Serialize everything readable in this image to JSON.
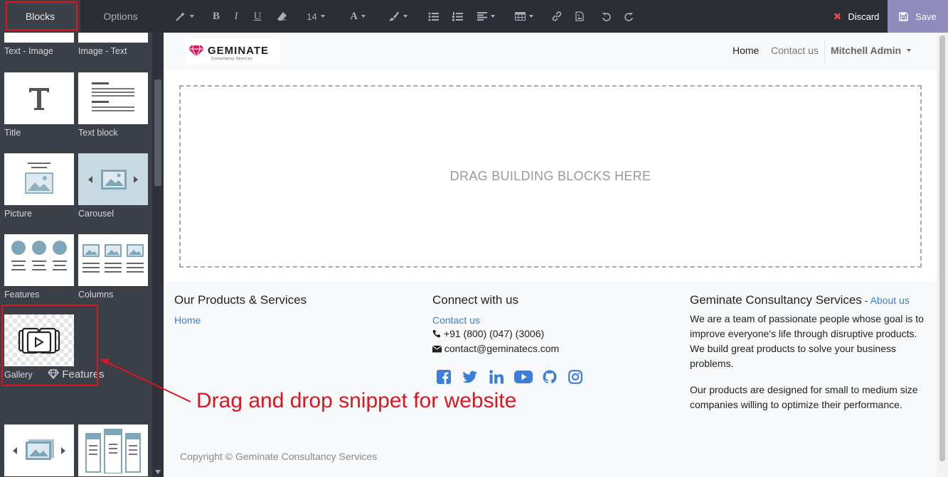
{
  "panel": {
    "tabs": [
      {
        "label": "Blocks",
        "active": true
      },
      {
        "label": "Options",
        "active": false
      }
    ],
    "snippets": [
      {
        "label": "Text - Image",
        "icon": "text-image-icon"
      },
      {
        "label": "Image - Text",
        "icon": "image-text-icon"
      },
      {
        "label": "Title",
        "icon": "title-icon"
      },
      {
        "label": "Text block",
        "icon": "text-block-icon"
      },
      {
        "label": "Picture",
        "icon": "picture-icon"
      },
      {
        "label": "Carousel",
        "icon": "carousel-icon"
      },
      {
        "label": "Features",
        "icon": "features-icon"
      },
      {
        "label": "Columns",
        "icon": "columns-icon"
      },
      {
        "label": "Gallery",
        "icon": "gallery-icon"
      }
    ],
    "category_title": "Features",
    "category_icon": "diamond-icon"
  },
  "toolbar": {
    "font_size": "14",
    "discard_label": "Discard",
    "save_label": "Save"
  },
  "site": {
    "logo_text": "GEMINATE",
    "logo_sub": "Consultancy Services",
    "nav": {
      "home": "Home",
      "contact": "Contact us",
      "user": "Mitchell Admin"
    },
    "dropzone_text": "DRAG BUILDING BLOCKS HERE",
    "footer": {
      "col1_title": "Our Products & Services",
      "col1_link": "Home",
      "col2_title": "Connect with us",
      "col2_link": "Contact us",
      "phone": "+91 (800) (047) (3006)",
      "email": "contact@geminatecs.com",
      "col3_title": "Geminate Consultancy Services",
      "col3_sep": " - ",
      "col3_link": "About us",
      "about_p1": "We are a team of passionate people whose goal is to improve everyone's life through disruptive products. We build great products to solve your business problems.",
      "about_p2": "Our products are designed for small to medium size companies willing to optimize their performance.",
      "copyright": "Copyright © Geminate Consultancy Services"
    }
  },
  "annotation": {
    "text": "Drag and drop snippet for website"
  },
  "colors": {
    "panel_bg": "#3b3f48",
    "toolbar_bg": "#2b2e35",
    "save_bg": "#8f8bbd",
    "link": "#3d7fd8",
    "annotation": "#e0141d",
    "logo_gem": "#d81b60"
  }
}
